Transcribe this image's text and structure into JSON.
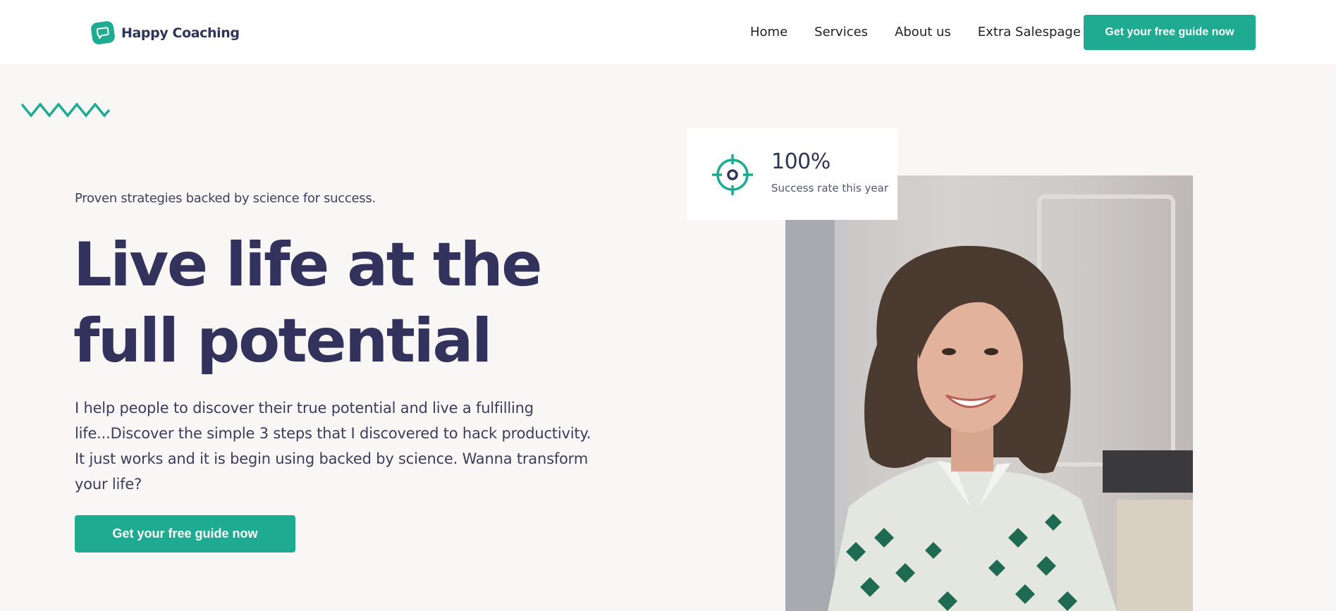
{
  "brand": {
    "name": "Happy Coaching",
    "accent": "#1fab91",
    "text_color": "#32325d"
  },
  "nav": {
    "links": [
      "Home",
      "Services",
      "About us",
      "Extra Salespage"
    ],
    "cta": "Get your free guide now"
  },
  "hero": {
    "eyebrow": "Proven strategies backed by science for success.",
    "headline_line1": "Live life at the",
    "headline_line2": "full potential",
    "lead": "I help people to discover their true potential and live a fulfilling life...Discover the simple 3 steps that I discovered to hack productivity. It just works and it is begin using backed by science. Wanna transform your life?",
    "cta": "Get your free guide now"
  },
  "stat": {
    "icon": "target-icon",
    "value": "100%",
    "label": "Success rate this year"
  },
  "photo": {
    "icon": "portrait-photo"
  }
}
